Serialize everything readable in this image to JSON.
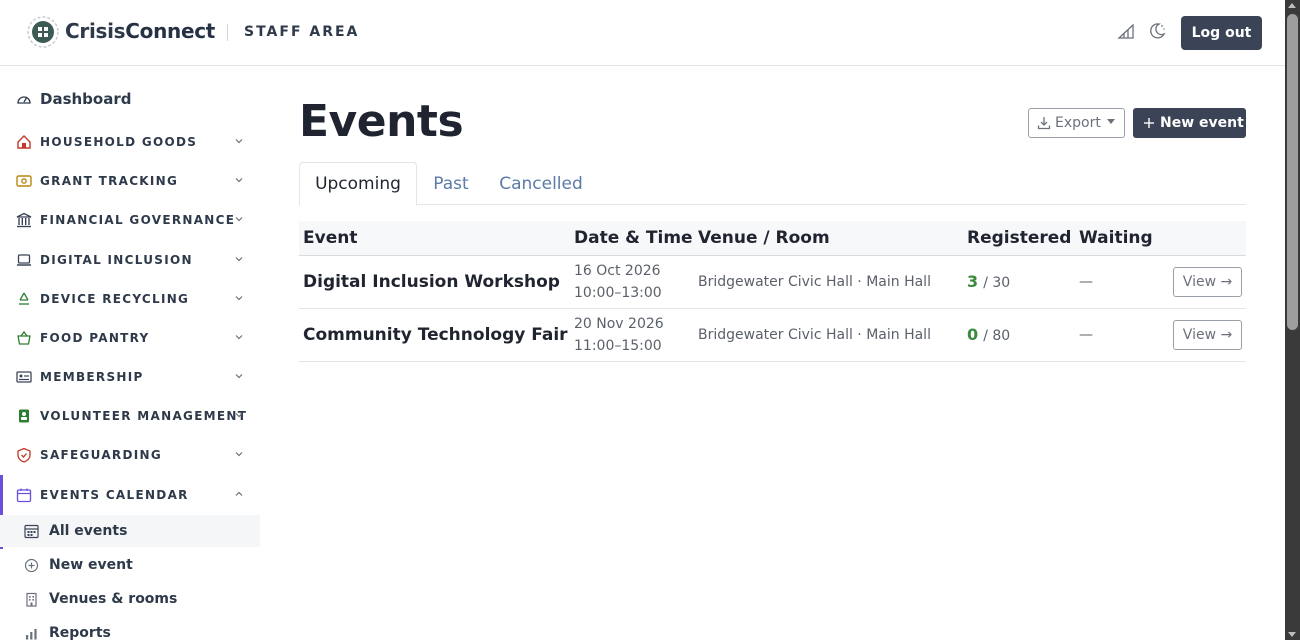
{
  "header": {
    "brand_part1": "Crisis",
    "brand_part2": "Connect",
    "section_label": "STAFF AREA",
    "logout_label": "Log out",
    "icons": [
      "chart-icon",
      "theme-toggle-icon"
    ]
  },
  "sidebar": {
    "dashboard_label": "Dashboard",
    "items": [
      {
        "label": "HOUSEHOLD GOODS",
        "icon": "house-icon",
        "expanded": false
      },
      {
        "label": "GRANT TRACKING",
        "icon": "grant-icon",
        "expanded": false
      },
      {
        "label": "FINANCIAL GOVERNANCE",
        "icon": "bank-icon",
        "expanded": false
      },
      {
        "label": "DIGITAL INCLUSION",
        "icon": "laptop-icon",
        "expanded": false
      },
      {
        "label": "DEVICE RECYCLING",
        "icon": "recycle-icon",
        "expanded": false
      },
      {
        "label": "FOOD PANTRY",
        "icon": "basket-icon",
        "expanded": false
      },
      {
        "label": "MEMBERSHIP",
        "icon": "card-icon",
        "expanded": false
      },
      {
        "label": "VOLUNTEER MANAGEMENT",
        "icon": "volunteer-icon",
        "expanded": false
      },
      {
        "label": "SAFEGUARDING",
        "icon": "shield-icon",
        "expanded": false
      },
      {
        "label": "EVENTS CALENDAR",
        "icon": "calendar-icon",
        "expanded": true
      }
    ],
    "sub_items": [
      {
        "label": "All events",
        "icon": "calendar-grid-icon",
        "active": true
      },
      {
        "label": "New event",
        "icon": "plus-circle-icon",
        "active": false
      },
      {
        "label": "Venues & rooms",
        "icon": "building-icon",
        "active": false
      },
      {
        "label": "Reports",
        "icon": "bar-chart-icon",
        "active": false
      }
    ]
  },
  "main": {
    "title": "Events",
    "export_label": "Export",
    "new_event_label": "New event",
    "tabs": [
      {
        "label": "Upcoming",
        "active": true
      },
      {
        "label": "Past",
        "active": false
      },
      {
        "label": "Cancelled",
        "active": false
      }
    ],
    "table": {
      "headers": [
        "Event",
        "Date & Time",
        "Venue / Room",
        "Registered",
        "Waiting"
      ],
      "rows": [
        {
          "event": "Digital Inclusion Workshop",
          "date": "16 Oct 2026",
          "time": "10:00–13:00",
          "venue": "Bridgewater Civic Hall · Main Hall",
          "registered": "3",
          "capacity": "/ 30",
          "waiting": "—",
          "action": "View →"
        },
        {
          "event": "Community Technology Fair",
          "date": "20 Nov 2026",
          "time": "11:00–15:00",
          "venue": "Bridgewater Civic Hall · Main Hall",
          "registered": "0",
          "capacity": "/ 80",
          "waiting": "—",
          "action": "View →"
        }
      ]
    }
  },
  "colors": {
    "primary_button": "#3b4457",
    "active_accent": "#6b4fd8",
    "registered_count": "#3c8a3c",
    "tab_link": "#5a7aa8",
    "icon_red": "#c0392b",
    "icon_green": "#2e7d32"
  }
}
